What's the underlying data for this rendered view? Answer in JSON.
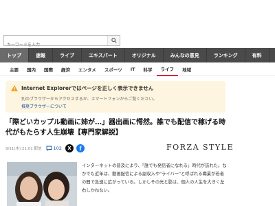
{
  "search": {
    "placeholder": "キーワードを入力"
  },
  "nav": {
    "categories": [
      {
        "label": "トップ"
      },
      {
        "label": "速報"
      },
      {
        "label": "ライブ"
      },
      {
        "label": "エキスパート"
      },
      {
        "label": "オリジナル"
      },
      {
        "label": "みんなの意見"
      },
      {
        "label": "ランキング"
      },
      {
        "label": "有料"
      }
    ],
    "subcategories": [
      {
        "label": "主要"
      },
      {
        "label": "国内"
      },
      {
        "label": "国際"
      },
      {
        "label": "経済"
      },
      {
        "label": "エンタメ"
      },
      {
        "label": "スポーツ"
      },
      {
        "label": "IT"
      },
      {
        "label": "科学"
      },
      {
        "label": "ライフ"
      },
      {
        "label": "地域"
      }
    ],
    "active_category": "トップ",
    "active_subcategory": "ライフ"
  },
  "notice": {
    "title": "Internet Explorerではページを正しく表示できません",
    "description": "別のブラウザーからアクセスするか、スマートフォンからご覧ください。",
    "link": "推奨ブラウザーについて"
  },
  "article": {
    "headline": "「際どいカップル動画に姉が…」器出画に愕然。誰でも配信で稼げる時代がもたらす人生崩壊【専門家解説】",
    "date": "9/11(木) 21:01 配信",
    "comment_count": "102",
    "source_logo": "FORZA STYLE",
    "body": "インターネットの普及により、「誰でも発信者になれる」時代が訪れた。なかでも近年は、動画配信による副収入や\"ライバー\"と呼ばれる職業が若者の間で急速に広がっている。しかしその光と影は、個人の人生を大きく左右しかねない。"
  },
  "colors": {
    "nav_bg": "#4a4a4a",
    "nav_active": "#6b6b6b",
    "notice_bg": "#fdf5df",
    "link": "#1a4f9c",
    "warning": "#f0a020",
    "facebook": "#1877f2"
  }
}
